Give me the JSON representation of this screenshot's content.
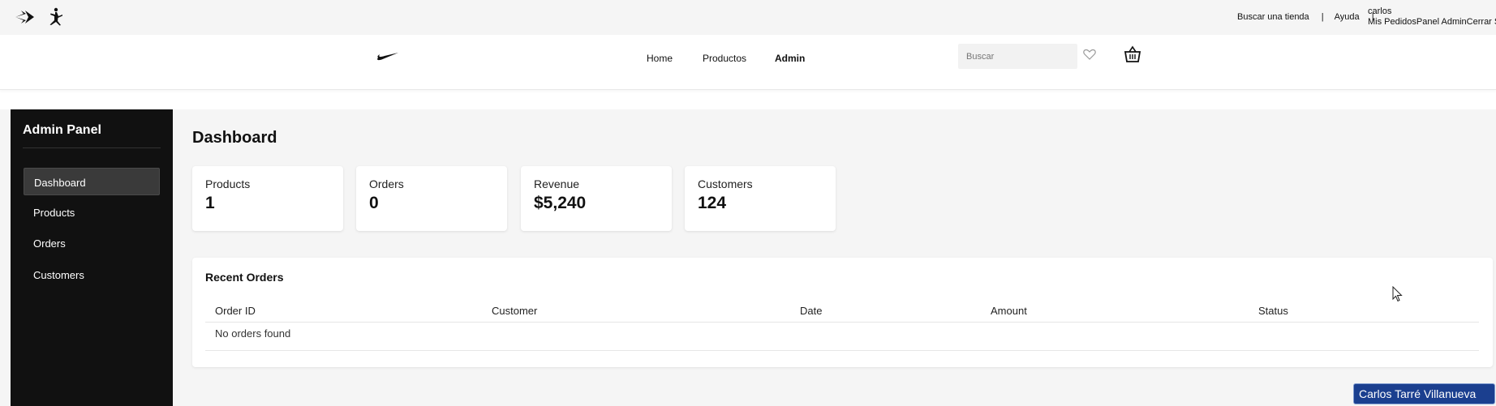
{
  "utility": {
    "links": [
      "Buscar una tienda",
      "Ayuda"
    ],
    "separator": "|",
    "user_name": "carlos",
    "user_links": "Mis PedidosPanel AdminCerrar Se"
  },
  "nav": {
    "links": [
      "Home",
      "Productos",
      "Admin"
    ],
    "active": "Admin",
    "search_placeholder": "Buscar"
  },
  "sidebar": {
    "title": "Admin Panel",
    "items": [
      "Dashboard",
      "Products",
      "Orders",
      "Customers"
    ],
    "active": "Dashboard"
  },
  "dashboard": {
    "title": "Dashboard",
    "stats": [
      {
        "label": "Products",
        "value": "1"
      },
      {
        "label": "Orders",
        "value": "0"
      },
      {
        "label": "Revenue",
        "value": "$5,240"
      },
      {
        "label": "Customers",
        "value": "124"
      }
    ]
  },
  "recent_orders": {
    "title": "Recent Orders",
    "columns": [
      "Order ID",
      "Customer",
      "Date",
      "Amount",
      "Status"
    ],
    "empty_message": "No orders found"
  },
  "badge": {
    "name": "Carlos Tarré Villanueva"
  },
  "colors": {
    "sidebar_bg": "#111111",
    "active_item": "#3a3a3a",
    "badge_bg": "#1b3f8f"
  }
}
